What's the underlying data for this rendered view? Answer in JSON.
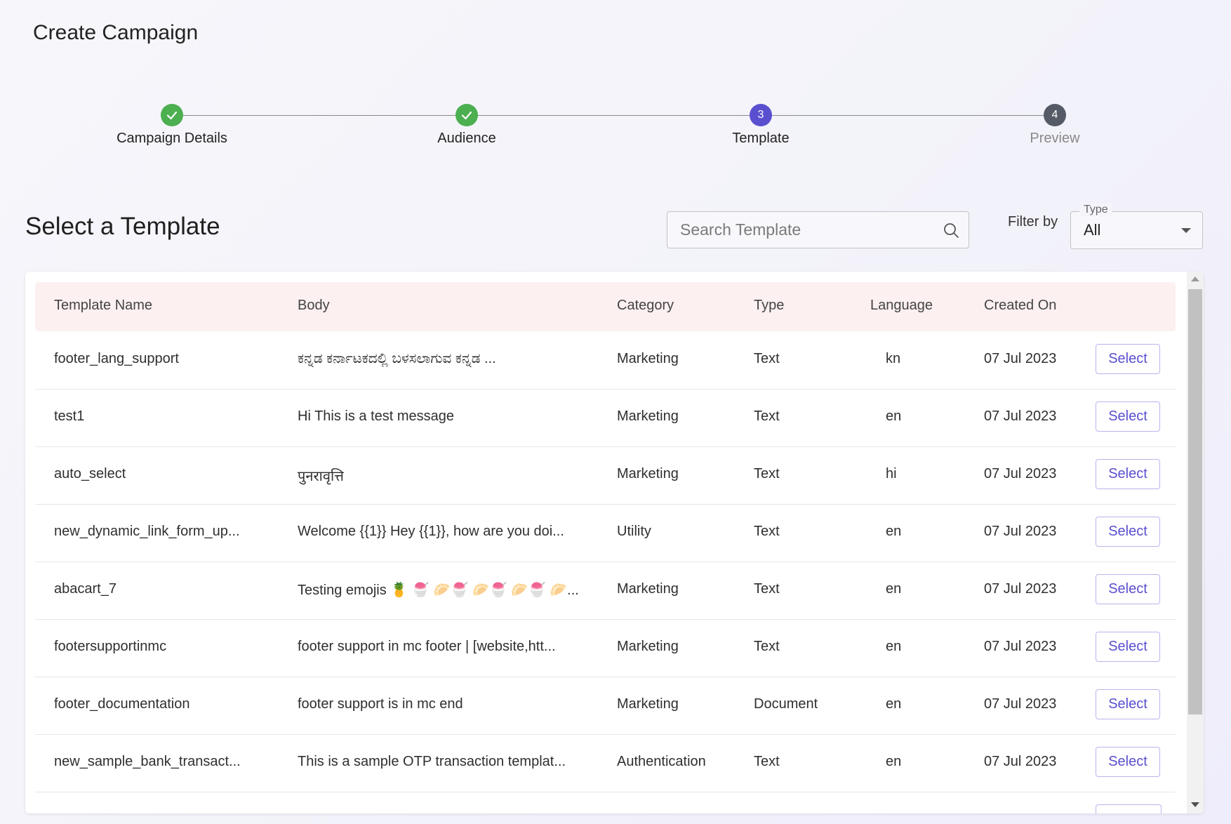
{
  "page": {
    "title": "Create Campaign"
  },
  "stepper": {
    "steps": [
      {
        "label": "Campaign Details",
        "state": "done",
        "number": ""
      },
      {
        "label": "Audience",
        "state": "done",
        "number": ""
      },
      {
        "label": "Template",
        "state": "active",
        "number": "3"
      },
      {
        "label": "Preview",
        "state": "todo",
        "number": "4"
      }
    ]
  },
  "section": {
    "title": "Select a Template"
  },
  "search": {
    "placeholder": "Search Template",
    "value": ""
  },
  "filter": {
    "label": "Filter by",
    "type_legend": "Type",
    "type_value": "All"
  },
  "table": {
    "headers": [
      "Template Name",
      "Body",
      "Category",
      "Type",
      "Language",
      "Created On"
    ],
    "rows": [
      {
        "name": "footer_lang_support",
        "body": "ಕನ್ನಡ ಕರ್ನಾಟಕದಲ್ಲಿ ಬಳಸಲಾಗುವ ಕನ್ನಡ ...",
        "category": "Marketing",
        "type": "Text",
        "language": "kn",
        "created": "07 Jul 2023",
        "action": "Select"
      },
      {
        "name": "test1",
        "body": "Hi This is a test message",
        "category": "Marketing",
        "type": "Text",
        "language": "en",
        "created": "07 Jul 2023",
        "action": "Select"
      },
      {
        "name": "auto_select",
        "body": "पुनरावृत्ति",
        "category": "Marketing",
        "type": "Text",
        "language": "hi",
        "created": "07 Jul 2023",
        "action": "Select"
      },
      {
        "name": "new_dynamic_link_form_up...",
        "body": "Welcome {{1}} Hey {{1}}, how are you doi...",
        "category": "Utility",
        "type": "Text",
        "language": "en",
        "created": "07 Jul 2023",
        "action": "Select"
      },
      {
        "name": "abacart_7",
        "body": "Testing emojis 🍍 🍧 🥟🍧 🥟🍧 🥟🍧 🥟...",
        "category": "Marketing",
        "type": "Text",
        "language": "en",
        "created": "07 Jul 2023",
        "action": "Select"
      },
      {
        "name": "footersupportinmc",
        "body": "footer support in mc footer | [website,htt...",
        "category": "Marketing",
        "type": "Text",
        "language": "en",
        "created": "07 Jul 2023",
        "action": "Select"
      },
      {
        "name": "footer_documentation",
        "body": "footer support is in mc end",
        "category": "Marketing",
        "type": "Document",
        "language": "en",
        "created": "07 Jul 2023",
        "action": "Select"
      },
      {
        "name": "new_sample_bank_transact...",
        "body": "This is a sample OTP transaction templat...",
        "category": "Authentication",
        "type": "Text",
        "language": "en",
        "created": "07 Jul 2023",
        "action": "Select"
      }
    ]
  },
  "colors": {
    "accent": "#5a4fcf",
    "success": "#4caf50",
    "header_bg": "#fcf0f1"
  },
  "icons": {
    "search": "search-icon",
    "check": "check-icon",
    "dropdown": "chevron-down-icon"
  }
}
